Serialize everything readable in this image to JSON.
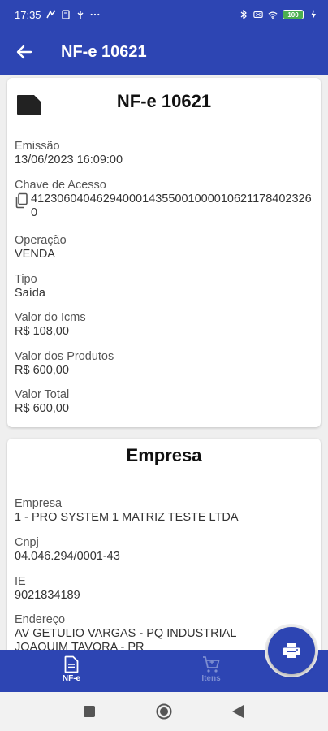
{
  "status_bar": {
    "time": "17:35",
    "battery": "100"
  },
  "app_bar": {
    "title": "NF-e 10621"
  },
  "nfe_card": {
    "title": "NF-e 10621",
    "fields": [
      {
        "label": "Emissão",
        "value": "13/06/2023 16:09:00"
      },
      {
        "label": "Chave de Acesso",
        "value": "41230604046294000143550010000106211784023260"
      },
      {
        "label": "Operação",
        "value": "VENDA"
      },
      {
        "label": "Tipo",
        "value": "Saída"
      },
      {
        "label": "Valor do Icms",
        "value": "R$ 108,00"
      },
      {
        "label": "Valor dos Produtos",
        "value": "R$ 600,00"
      },
      {
        "label": "Valor Total",
        "value": "R$ 600,00"
      }
    ]
  },
  "empresa_card": {
    "title": "Empresa",
    "fields": [
      {
        "label": "Empresa",
        "value": "1 - PRO SYSTEM 1 MATRIZ TESTE LTDA"
      },
      {
        "label": "Cnpj",
        "value": "04.046.294/0001-43"
      },
      {
        "label": "IE",
        "value": "9021834189"
      },
      {
        "label": "Endereço",
        "value": "AV GETULIO VARGAS - PQ INDUSTRIAL"
      },
      {
        "label": "",
        "value": "JOAQUIM TAVORA - PR"
      }
    ]
  },
  "bottom_nav": {
    "items": [
      {
        "label": "NF-e",
        "icon": "document-icon",
        "active": true
      },
      {
        "label": "Itens",
        "icon": "cart-icon",
        "active": false
      }
    ]
  },
  "colors": {
    "primary": "#2d45b3",
    "inactive_nav": "#7d8ed1",
    "background": "#efefef"
  }
}
